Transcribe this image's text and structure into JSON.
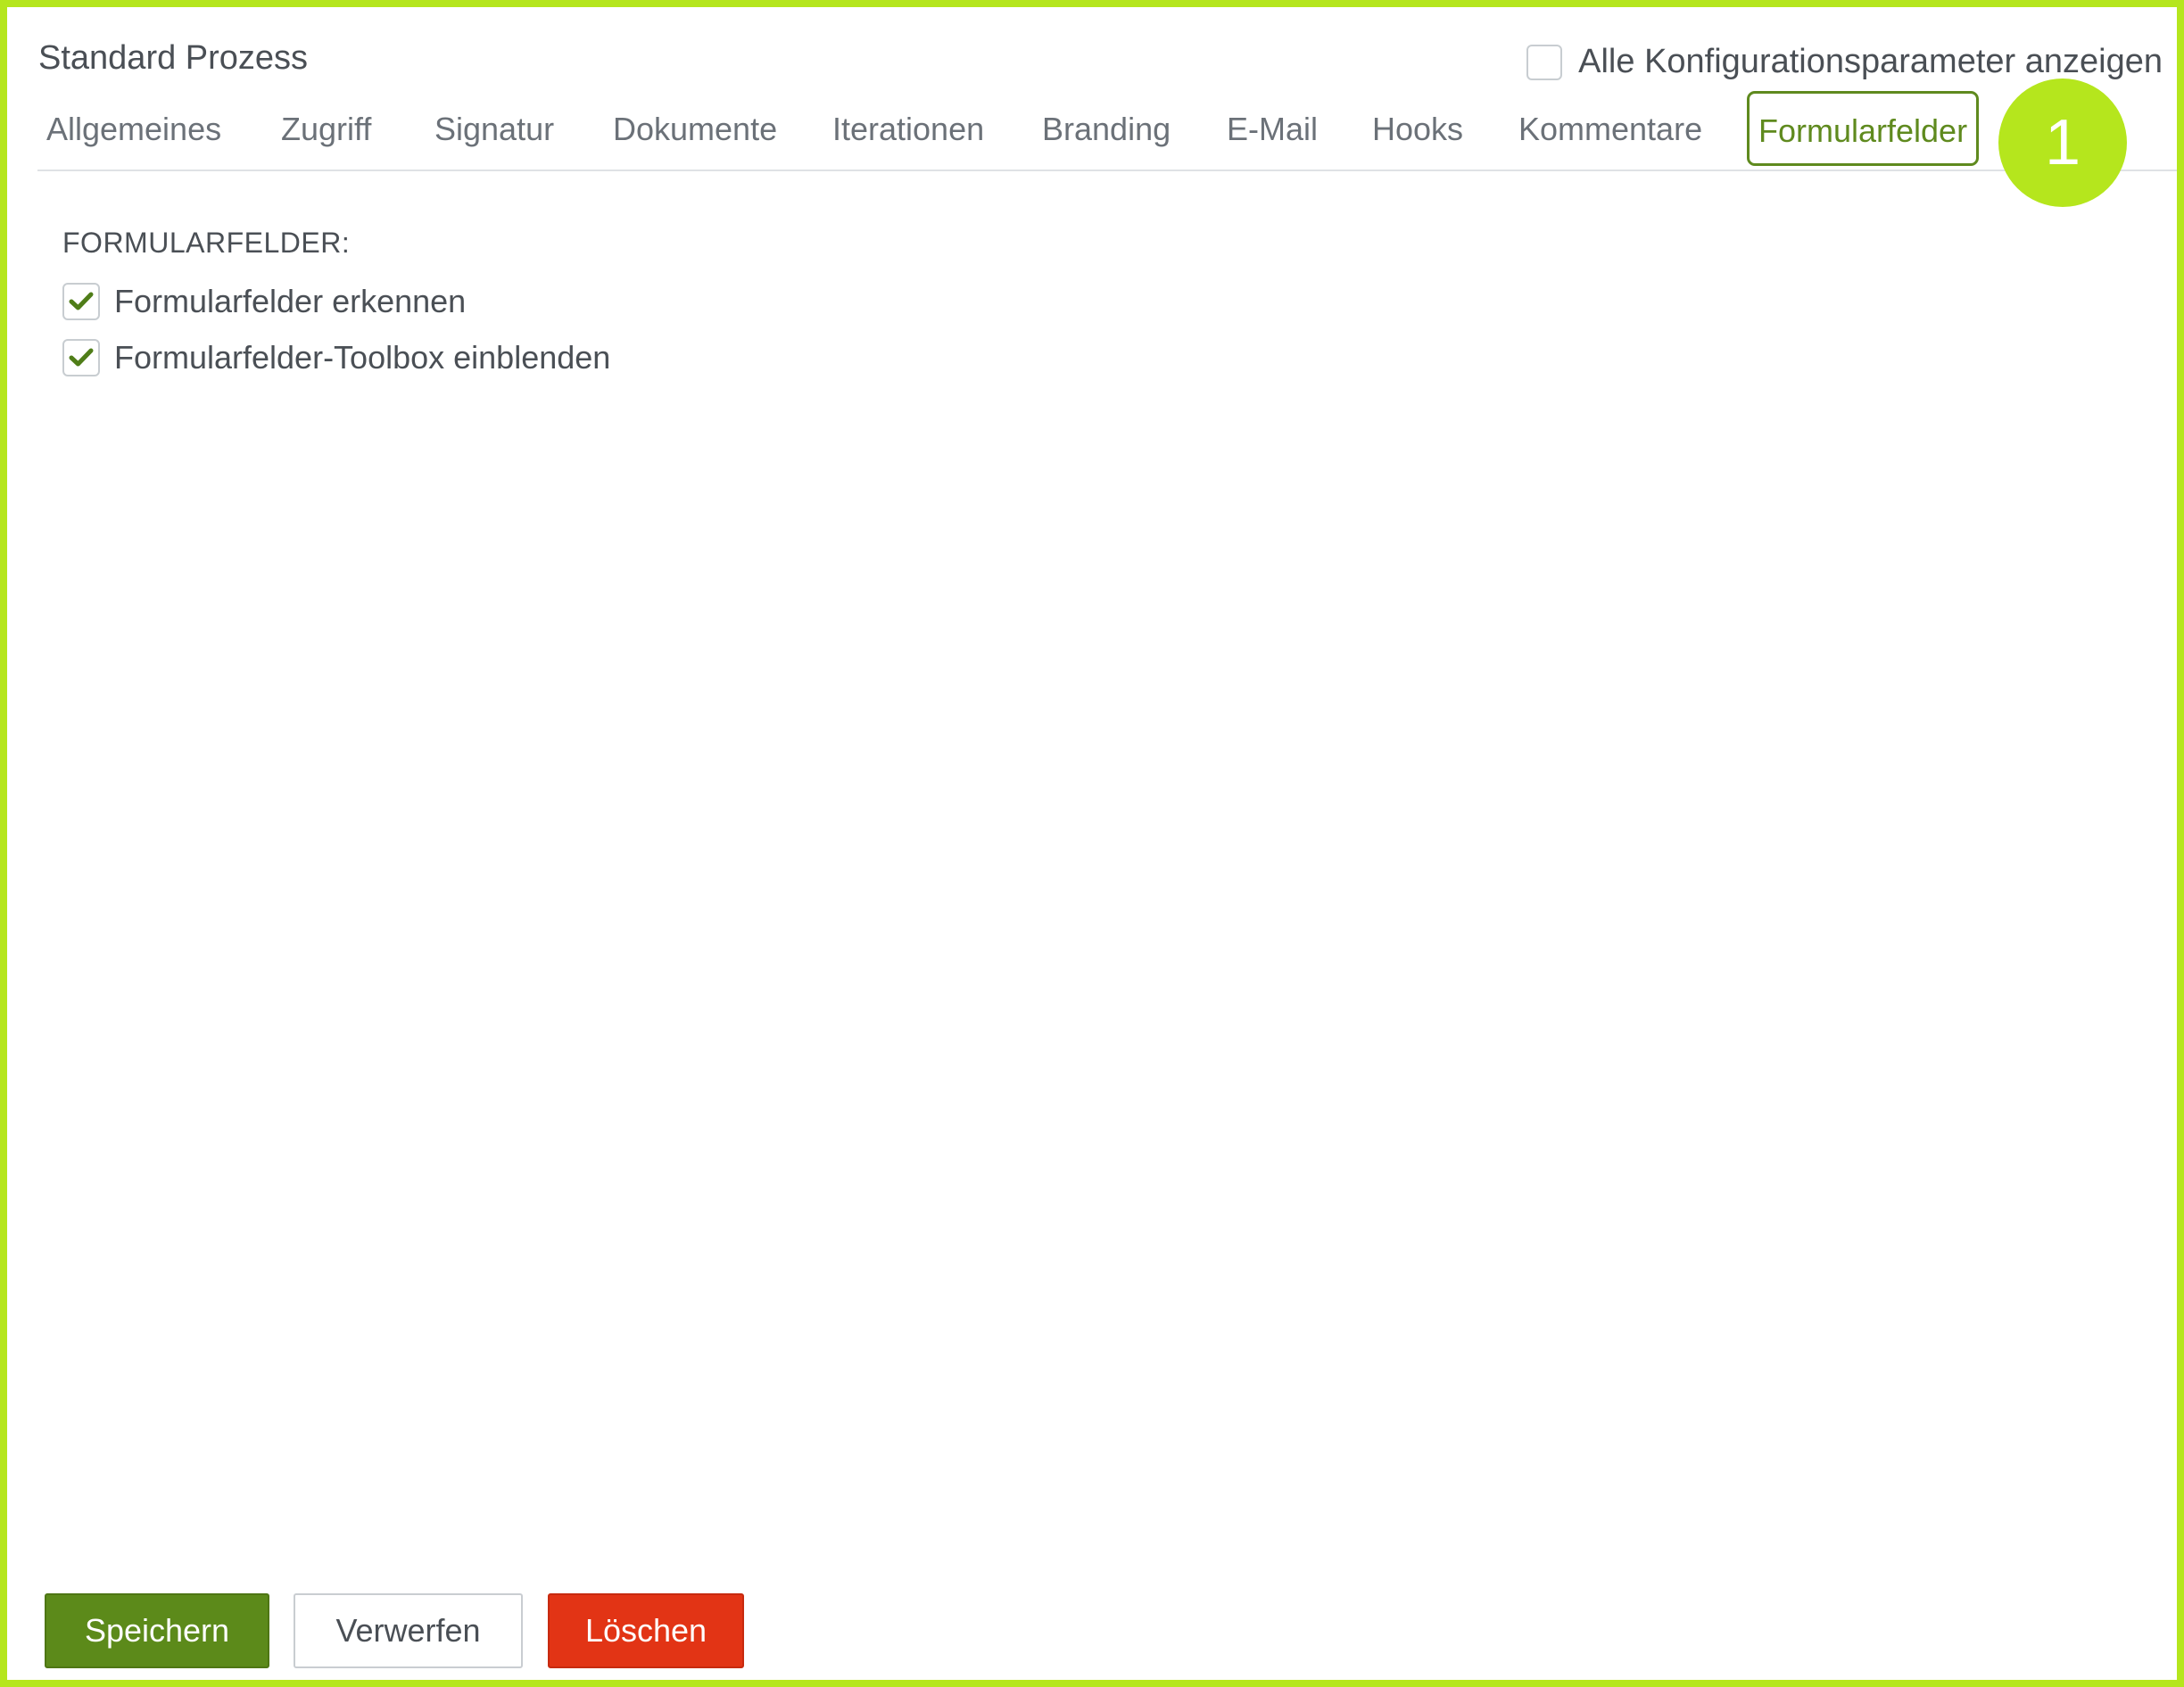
{
  "header": {
    "title": "Standard Prozess"
  },
  "show_all": {
    "label": "Alle Konfigurationsparameter anzeigen",
    "checked": false
  },
  "tabs": [
    {
      "label": "Allgemeines"
    },
    {
      "label": "Zugriff"
    },
    {
      "label": "Signatur"
    },
    {
      "label": "Dokumente"
    },
    {
      "label": "Iterationen"
    },
    {
      "label": "Branding"
    },
    {
      "label": "E-Mail"
    },
    {
      "label": "Hooks"
    },
    {
      "label": "Kommentare"
    },
    {
      "label": "Formularfelder",
      "active": true
    }
  ],
  "marker": {
    "number": "1"
  },
  "section": {
    "title": "FORMULARFELDER:",
    "options": [
      {
        "label": "Formularfelder erkennen",
        "checked": true
      },
      {
        "label": "Formularfelder-Toolbox einblenden",
        "checked": true
      }
    ]
  },
  "actions": {
    "save": "Speichern",
    "discard": "Verwerfen",
    "delete": "Löschen"
  },
  "colors": {
    "frame": "#b5e61d",
    "accent": "#5f8a1e",
    "save_bg": "#5c8a1a",
    "delete_bg": "#e23415"
  }
}
